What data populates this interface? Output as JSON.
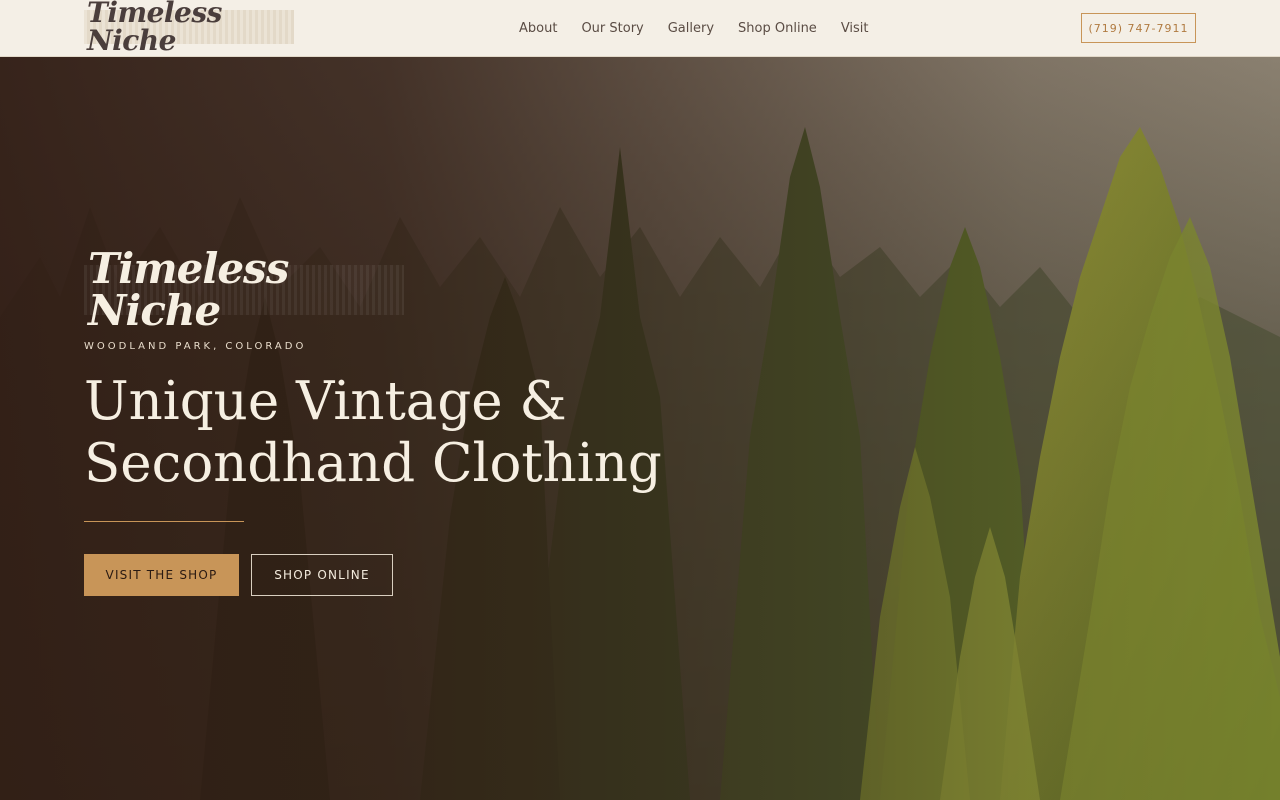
{
  "header": {
    "logo_text": "Timeless Niche",
    "nav": [
      {
        "label": "About"
      },
      {
        "label": "Our Story"
      },
      {
        "label": "Gallery"
      },
      {
        "label": "Shop Online"
      },
      {
        "label": "Visit"
      }
    ],
    "phone": "(719) 747-7911"
  },
  "hero": {
    "logo_text": "Timeless Niche",
    "location": "WOODLAND PARK, COLORADO",
    "heading_line1": "Unique Vintage &",
    "heading_line2": "Secondhand Clothing",
    "primary_button": "VISIT THE SHOP",
    "secondary_button": "SHOP ONLINE"
  },
  "colors": {
    "header_bg": "#f4efe6",
    "accent": "#c89558",
    "hero_overlay": "#301c14",
    "text_light": "#f6efe2"
  }
}
